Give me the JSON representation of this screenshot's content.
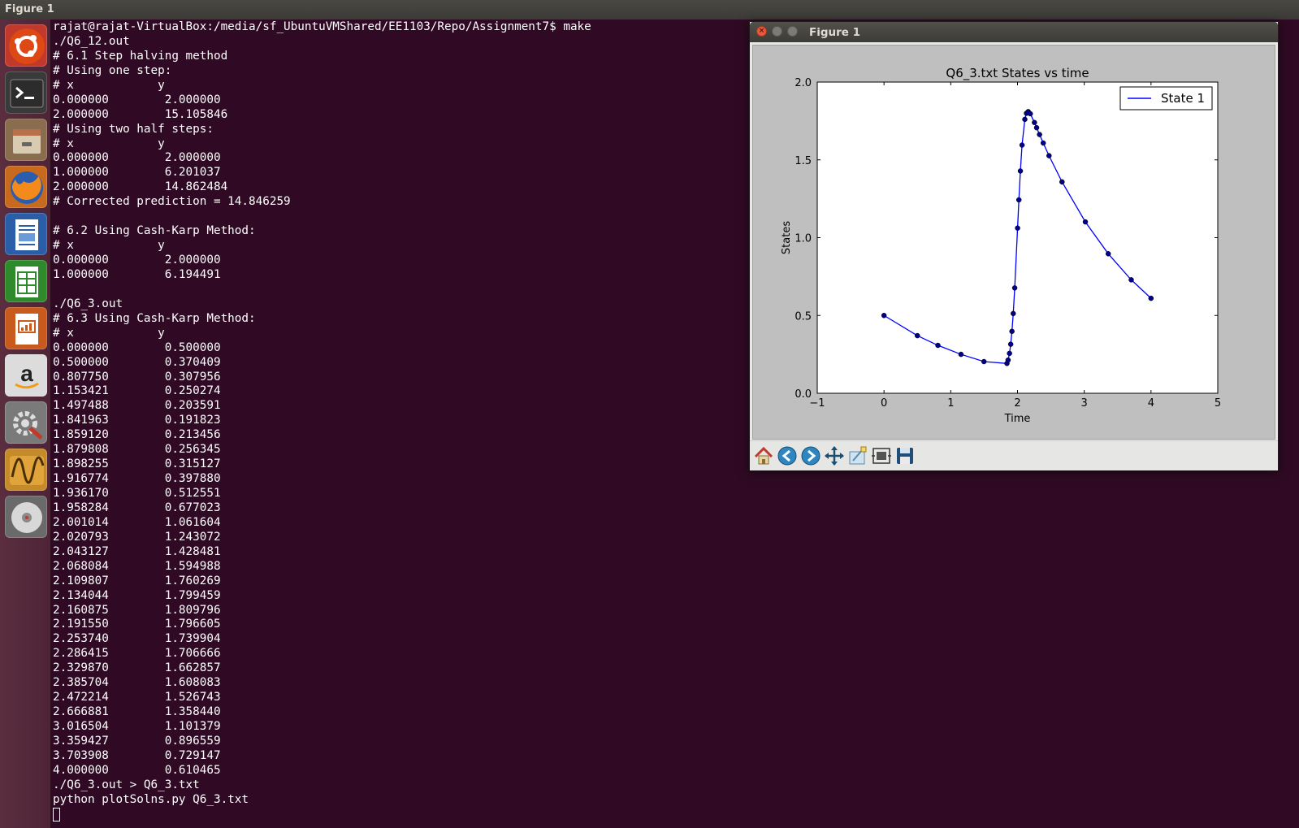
{
  "top_panel": {
    "title": "Figure 1"
  },
  "launcher": {
    "items": [
      {
        "name": "ubuntu-dash-icon"
      },
      {
        "name": "terminal-icon"
      },
      {
        "name": "files-icon"
      },
      {
        "name": "firefox-icon"
      },
      {
        "name": "writer-icon"
      },
      {
        "name": "calc-icon"
      },
      {
        "name": "impress-icon"
      },
      {
        "name": "amazon-icon"
      },
      {
        "name": "settings-icon"
      },
      {
        "name": "oscilloscope-icon"
      },
      {
        "name": "dvd-icon"
      }
    ]
  },
  "terminal": {
    "lines": [
      "rajat@rajat-VirtualBox:/media/sf_UbuntuVMShared/EE1103/Repo/Assignment7$ make",
      "./Q6_12.out",
      "# 6.1 Step halving method",
      "# Using one step:",
      "# x            y",
      "0.000000        2.000000",
      "2.000000        15.105846",
      "# Using two half steps:",
      "# x            y",
      "0.000000        2.000000",
      "1.000000        6.201037",
      "2.000000        14.862484",
      "# Corrected prediction = 14.846259",
      "",
      "# 6.2 Using Cash-Karp Method:",
      "# x            y",
      "0.000000        2.000000",
      "1.000000        6.194491",
      "",
      "./Q6_3.out",
      "# 6.3 Using Cash-Karp Method:",
      "# x            y",
      "0.000000        0.500000",
      "0.500000        0.370409",
      "0.807750        0.307956",
      "1.153421        0.250274",
      "1.497488        0.203591",
      "1.841963        0.191823",
      "1.859120        0.213456",
      "1.879808        0.256345",
      "1.898255        0.315127",
      "1.916774        0.397880",
      "1.936170        0.512551",
      "1.958284        0.677023",
      "2.001014        1.061604",
      "2.020793        1.243072",
      "2.043127        1.428481",
      "2.068084        1.594988",
      "2.109807        1.760269",
      "2.134044        1.799459",
      "2.160875        1.809796",
      "2.191550        1.796605",
      "2.253740        1.739904",
      "2.286415        1.706666",
      "2.329870        1.662857",
      "2.385704        1.608083",
      "2.472214        1.526743",
      "2.666881        1.358440",
      "3.016504        1.101379",
      "3.359427        0.896559",
      "3.703908        0.729147",
      "4.000000        0.610465",
      "./Q6_3.out > Q6_3.txt",
      "python plotSolns.py Q6_3.txt"
    ]
  },
  "figure_window": {
    "title": "Figure 1",
    "toolbar": [
      {
        "name": "home-icon"
      },
      {
        "name": "back-icon"
      },
      {
        "name": "forward-icon"
      },
      {
        "name": "pan-icon"
      },
      {
        "name": "zoom-icon"
      },
      {
        "name": "subplots-icon"
      },
      {
        "name": "save-icon"
      }
    ]
  },
  "chart_data": {
    "type": "line",
    "title": "Q6_3.txt States vs time",
    "xlabel": "Time",
    "ylabel": "States",
    "xlim": [
      -1,
      5
    ],
    "ylim": [
      0.0,
      2.0
    ],
    "xticks": [
      "−1",
      "0",
      "1",
      "2",
      "3",
      "4",
      "5"
    ],
    "yticks": [
      "0.0",
      "0.5",
      "1.0",
      "1.5",
      "2.0"
    ],
    "grid": false,
    "legend_position": "top-right",
    "line_color": "#0000ff",
    "marker_color": "#00008b",
    "series": [
      {
        "name": "State 1",
        "x": [
          0.0,
          0.5,
          0.80775,
          1.153421,
          1.497488,
          1.841963,
          1.85912,
          1.879808,
          1.898255,
          1.916774,
          1.93617,
          1.958284,
          2.001014,
          2.020793,
          2.043127,
          2.068084,
          2.109807,
          2.134044,
          2.160875,
          2.19155,
          2.25374,
          2.286415,
          2.32987,
          2.385704,
          2.472214,
          2.666881,
          3.016504,
          3.359427,
          3.703908,
          4.0
        ],
        "y": [
          0.5,
          0.370409,
          0.307956,
          0.250274,
          0.203591,
          0.191823,
          0.213456,
          0.256345,
          0.315127,
          0.39788,
          0.512551,
          0.677023,
          1.061604,
          1.243072,
          1.428481,
          1.594988,
          1.760269,
          1.799459,
          1.809796,
          1.796605,
          1.739904,
          1.706666,
          1.662857,
          1.608083,
          1.526743,
          1.35844,
          1.101379,
          0.896559,
          0.729147,
          0.610465
        ]
      }
    ]
  }
}
